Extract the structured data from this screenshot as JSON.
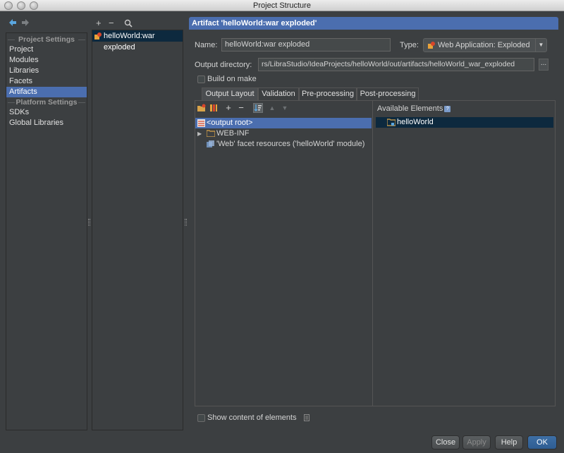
{
  "window": {
    "title": "Project Structure"
  },
  "left": {
    "project_settings_title": "Project Settings",
    "project_items": [
      "Project",
      "Modules",
      "Libraries",
      "Facets",
      "Artifacts"
    ],
    "platform_settings_title": "Platform Settings",
    "platform_items": [
      "SDKs",
      "Global Libraries"
    ],
    "selected": "Artifacts"
  },
  "artifacts": {
    "toolbar": {
      "add": "+",
      "remove": "−"
    },
    "items": [
      "helloWorld:war exploded"
    ]
  },
  "detail": {
    "header": "Artifact 'helloWorld:war exploded'",
    "name_label": "Name:",
    "name_value": "helloWorld:war exploded",
    "type_label": "Type:",
    "type_value": "Web Application: Exploded",
    "output_label": "Output directory:",
    "output_value": "rs/LibraStudio/IdeaProjects/helloWorld/out/artifacts/helloWorld_war_exploded",
    "browse_label": "...",
    "build_on_make_label": "Build on make",
    "tabs": [
      "Output Layout",
      "Validation",
      "Pre-processing",
      "Post-processing"
    ],
    "tree": [
      {
        "label": "<output root>",
        "icon": "output-root-icon"
      },
      {
        "label": "WEB-INF",
        "icon": "folder-icon"
      },
      {
        "label": "'Web' facet resources ('helloWorld' module)",
        "icon": "web-facet-icon"
      }
    ],
    "available_title": "Available Elements",
    "help_badge": "?",
    "available_items": [
      "helloWorld"
    ],
    "show_content_label": "Show content of elements"
  },
  "buttons": {
    "close": "Close",
    "apply": "Apply",
    "help": "Help",
    "ok": "OK"
  },
  "colors": {
    "selection": "#4b6eaf",
    "background": "#3c3f41",
    "dark_selection": "#0d293e"
  }
}
